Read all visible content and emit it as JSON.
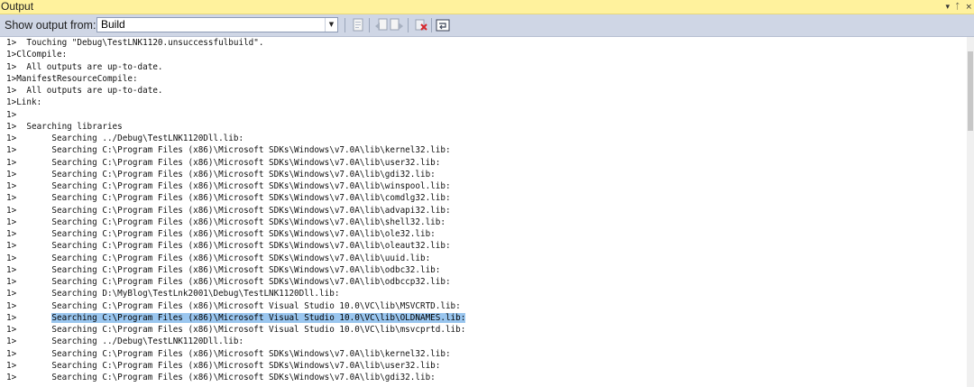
{
  "panel": {
    "title": "Output",
    "controls": {
      "dropdown_glyph": "▾",
      "pin_glyph": "ᛏ",
      "close_glyph": "×"
    }
  },
  "toolbar": {
    "show_output_label": "Show output from:",
    "source_value": "Build",
    "dropdown_arrow": "▼"
  },
  "output": {
    "highlighted_line_index": 23,
    "lines": [
      {
        "prefix": "1>  ",
        "text": "Touching \"Debug\\TestLNK1120.unsuccessfulbuild\"."
      },
      {
        "prefix": "1>",
        "text": "ClCompile:"
      },
      {
        "prefix": "1>  ",
        "text": "All outputs are up-to-date."
      },
      {
        "prefix": "1>",
        "text": "ManifestResourceCompile:"
      },
      {
        "prefix": "1>  ",
        "text": "All outputs are up-to-date."
      },
      {
        "prefix": "1>",
        "text": "Link:"
      },
      {
        "prefix": "1>",
        "text": ""
      },
      {
        "prefix": "1>  ",
        "text": "Searching libraries"
      },
      {
        "prefix": "1>       ",
        "text": "Searching ../Debug\\TestLNK1120Dll.lib:"
      },
      {
        "prefix": "1>       ",
        "text": "Searching C:\\Program Files (x86)\\Microsoft SDKs\\Windows\\v7.0A\\lib\\kernel32.lib:"
      },
      {
        "prefix": "1>       ",
        "text": "Searching C:\\Program Files (x86)\\Microsoft SDKs\\Windows\\v7.0A\\lib\\user32.lib:"
      },
      {
        "prefix": "1>       ",
        "text": "Searching C:\\Program Files (x86)\\Microsoft SDKs\\Windows\\v7.0A\\lib\\gdi32.lib:"
      },
      {
        "prefix": "1>       ",
        "text": "Searching C:\\Program Files (x86)\\Microsoft SDKs\\Windows\\v7.0A\\lib\\winspool.lib:"
      },
      {
        "prefix": "1>       ",
        "text": "Searching C:\\Program Files (x86)\\Microsoft SDKs\\Windows\\v7.0A\\lib\\comdlg32.lib:"
      },
      {
        "prefix": "1>       ",
        "text": "Searching C:\\Program Files (x86)\\Microsoft SDKs\\Windows\\v7.0A\\lib\\advapi32.lib:"
      },
      {
        "prefix": "1>       ",
        "text": "Searching C:\\Program Files (x86)\\Microsoft SDKs\\Windows\\v7.0A\\lib\\shell32.lib:"
      },
      {
        "prefix": "1>       ",
        "text": "Searching C:\\Program Files (x86)\\Microsoft SDKs\\Windows\\v7.0A\\lib\\ole32.lib:"
      },
      {
        "prefix": "1>       ",
        "text": "Searching C:\\Program Files (x86)\\Microsoft SDKs\\Windows\\v7.0A\\lib\\oleaut32.lib:"
      },
      {
        "prefix": "1>       ",
        "text": "Searching C:\\Program Files (x86)\\Microsoft SDKs\\Windows\\v7.0A\\lib\\uuid.lib:"
      },
      {
        "prefix": "1>       ",
        "text": "Searching C:\\Program Files (x86)\\Microsoft SDKs\\Windows\\v7.0A\\lib\\odbc32.lib:"
      },
      {
        "prefix": "1>       ",
        "text": "Searching C:\\Program Files (x86)\\Microsoft SDKs\\Windows\\v7.0A\\lib\\odbccp32.lib:"
      },
      {
        "prefix": "1>       ",
        "text": "Searching D:\\MyBlog\\TestLnk2001\\Debug\\TestLNK1120Dll.lib:"
      },
      {
        "prefix": "1>       ",
        "text": "Searching C:\\Program Files (x86)\\Microsoft Visual Studio 10.0\\VC\\lib\\MSVCRTD.lib:"
      },
      {
        "prefix": "1>       ",
        "text": "Searching C:\\Program Files (x86)\\Microsoft Visual Studio 10.0\\VC\\lib\\OLDNAMES.lib:"
      },
      {
        "prefix": "1>       ",
        "text": "Searching C:\\Program Files (x86)\\Microsoft Visual Studio 10.0\\VC\\lib\\msvcprtd.lib:"
      },
      {
        "prefix": "1>       ",
        "text": "Searching ../Debug\\TestLNK1120Dll.lib:"
      },
      {
        "prefix": "1>       ",
        "text": "Searching C:\\Program Files (x86)\\Microsoft SDKs\\Windows\\v7.0A\\lib\\kernel32.lib:"
      },
      {
        "prefix": "1>       ",
        "text": "Searching C:\\Program Files (x86)\\Microsoft SDKs\\Windows\\v7.0A\\lib\\user32.lib:"
      },
      {
        "prefix": "1>       ",
        "text": "Searching C:\\Program Files (x86)\\Microsoft SDKs\\Windows\\v7.0A\\lib\\gdi32.lib:"
      }
    ]
  },
  "icons": {
    "go_to_message": "goto-location-icon",
    "find_previous": "find-previous-message-icon",
    "find_next": "find-next-message-icon",
    "clear_all": "clear-all-icon",
    "word_wrap": "toggle-word-wrap-icon"
  }
}
